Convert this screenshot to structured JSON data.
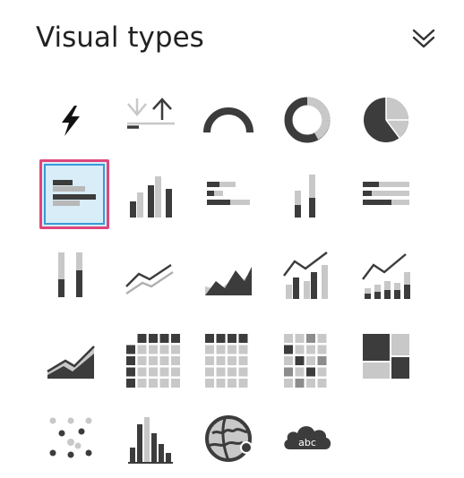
{
  "panel": {
    "title": "Visual types",
    "collapse_icon": "double-chevron-down-icon"
  },
  "visual_types": [
    {
      "icon": "autograph-lightning-icon",
      "selected": false
    },
    {
      "icon": "kpi-icon",
      "selected": false
    },
    {
      "icon": "gauge-chart-icon",
      "selected": false
    },
    {
      "icon": "donut-chart-icon",
      "selected": false
    },
    {
      "icon": "pie-chart-icon",
      "selected": false
    },
    {
      "icon": "horizontal-bar-chart-icon",
      "selected": true
    },
    {
      "icon": "vertical-bar-chart-icon",
      "selected": false
    },
    {
      "icon": "horizontal-stacked-bar-chart-icon",
      "selected": false
    },
    {
      "icon": "vertical-stacked-bar-chart-icon",
      "selected": false
    },
    {
      "icon": "horizontal-stacked-100-bar-chart-icon",
      "selected": false
    },
    {
      "icon": "vertical-stacked-100-bar-chart-icon",
      "selected": false
    },
    {
      "icon": "line-chart-icon",
      "selected": false
    },
    {
      "icon": "area-line-chart-icon",
      "selected": false
    },
    {
      "icon": "clustered-bar-combo-chart-icon",
      "selected": false
    },
    {
      "icon": "stacked-bar-combo-chart-icon",
      "selected": false
    },
    {
      "icon": "area-chart-icon",
      "selected": false
    },
    {
      "icon": "pivot-table-icon",
      "selected": false
    },
    {
      "icon": "table-icon",
      "selected": false
    },
    {
      "icon": "heat-map-icon",
      "selected": false
    },
    {
      "icon": "tree-map-icon",
      "selected": false
    },
    {
      "icon": "scatter-plot-icon",
      "selected": false
    },
    {
      "icon": "histogram-icon",
      "selected": false
    },
    {
      "icon": "geospatial-map-icon",
      "selected": false
    },
    {
      "icon": "word-cloud-icon",
      "selected": false
    }
  ],
  "colors": {
    "dark": "#3c3c3c",
    "light": "#c8c8c8",
    "selected_bg": "#d8edf8",
    "selected_border": "#e0457b",
    "selected_inner": "#3a9ad9"
  },
  "word_cloud_text": "abc"
}
